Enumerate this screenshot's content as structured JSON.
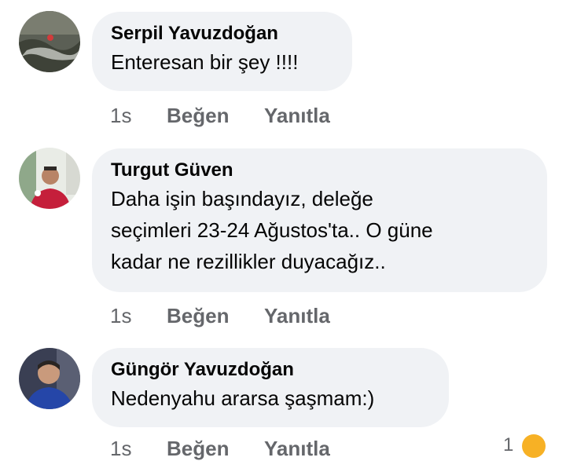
{
  "comments": [
    {
      "author": "Serpil Yavuzdoğan",
      "lines": [
        "Enteresan bir şey !!!!"
      ],
      "time": "1s",
      "like_label": "Beğen",
      "reply_label": "Yanıtla"
    },
    {
      "author": "Turgut Güven",
      "lines": [
        "Daha işin başındayız, deleğe",
        "seçimleri 23-24 Ağustos'ta.. O güne",
        "kadar ne rezillikler duyacağız.."
      ],
      "time": "1s",
      "like_label": "Beğen",
      "reply_label": "Yanıtla"
    },
    {
      "author": "Güngör Yavuzdoğan",
      "lines": [
        "Nedenyahu ararsa şaşmam:)"
      ],
      "time": "1s",
      "like_label": "Beğen",
      "reply_label": "Yanıtla",
      "reaction_icon": "laugh-reaction-icon",
      "reaction_count": "1"
    }
  ],
  "colors": {
    "bubble_bg": "#f0f2f5",
    "meta_text": "#65676b",
    "reaction": "#f7b125"
  }
}
